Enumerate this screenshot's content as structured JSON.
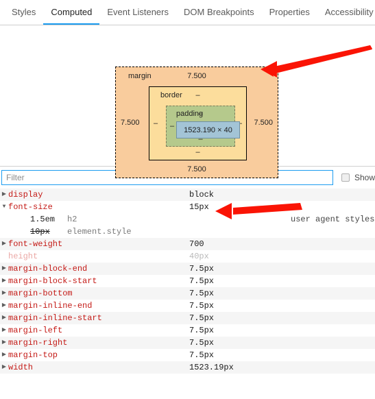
{
  "tabs": [
    {
      "label": "Styles",
      "active": false
    },
    {
      "label": "Computed",
      "active": true
    },
    {
      "label": "Event Listeners",
      "active": false
    },
    {
      "label": "DOM Breakpoints",
      "active": false
    },
    {
      "label": "Properties",
      "active": false
    },
    {
      "label": "Accessibility",
      "active": false
    }
  ],
  "box_model": {
    "margin": {
      "label": "margin",
      "top": "7.500",
      "right": "7.500",
      "bottom": "7.500",
      "left": "7.500",
      "color": "#f9cc9d"
    },
    "border": {
      "label": "border",
      "top": "–",
      "right": "–",
      "bottom": "–",
      "left": "–",
      "color": "#fcdd9c"
    },
    "padding": {
      "label": "padding",
      "top": "–",
      "right": "–",
      "bottom": "–",
      "left": "–",
      "color": "#b5c98c"
    },
    "content": {
      "dimensions": "1523.190 × 40",
      "color": "#a3c4d6"
    }
  },
  "filter": {
    "placeholder": "Filter",
    "value": "",
    "show_all_label": "Show",
    "show_all_checked": false
  },
  "properties": [
    {
      "name": "display",
      "value": "block",
      "expanded": false,
      "inherited": false
    },
    {
      "name": "font-size",
      "value": "15px",
      "expanded": true,
      "inherited": false
    },
    {
      "name": "font-weight",
      "value": "700",
      "expanded": false,
      "inherited": false
    },
    {
      "name": "height",
      "value": "40px",
      "expanded": null,
      "inherited": true
    },
    {
      "name": "margin-block-end",
      "value": "7.5px",
      "expanded": false,
      "inherited": false
    },
    {
      "name": "margin-block-start",
      "value": "7.5px",
      "expanded": false,
      "inherited": false
    },
    {
      "name": "margin-bottom",
      "value": "7.5px",
      "expanded": false,
      "inherited": false
    },
    {
      "name": "margin-inline-end",
      "value": "7.5px",
      "expanded": false,
      "inherited": false
    },
    {
      "name": "margin-inline-start",
      "value": "7.5px",
      "expanded": false,
      "inherited": false
    },
    {
      "name": "margin-left",
      "value": "7.5px",
      "expanded": false,
      "inherited": false
    },
    {
      "name": "margin-right",
      "value": "7.5px",
      "expanded": false,
      "inherited": false
    },
    {
      "name": "margin-top",
      "value": "7.5px",
      "expanded": false,
      "inherited": false
    },
    {
      "name": "width",
      "value": "1523.19px",
      "expanded": false,
      "inherited": false
    }
  ],
  "font_size_trace": [
    {
      "value": "1.5em",
      "selector": "h2",
      "origin": "user agent stylesheet",
      "struck": false
    },
    {
      "value": "10px",
      "selector": "element.style",
      "origin": "",
      "struck": true
    }
  ],
  "annotations": {
    "arrow_color": "#fa1405",
    "arrow_1_target": "box-model-margin-right",
    "arrow_2_target": "font-size-value"
  },
  "icons": {
    "triangle_collapsed": "▶",
    "triangle_expanded": "▼"
  }
}
